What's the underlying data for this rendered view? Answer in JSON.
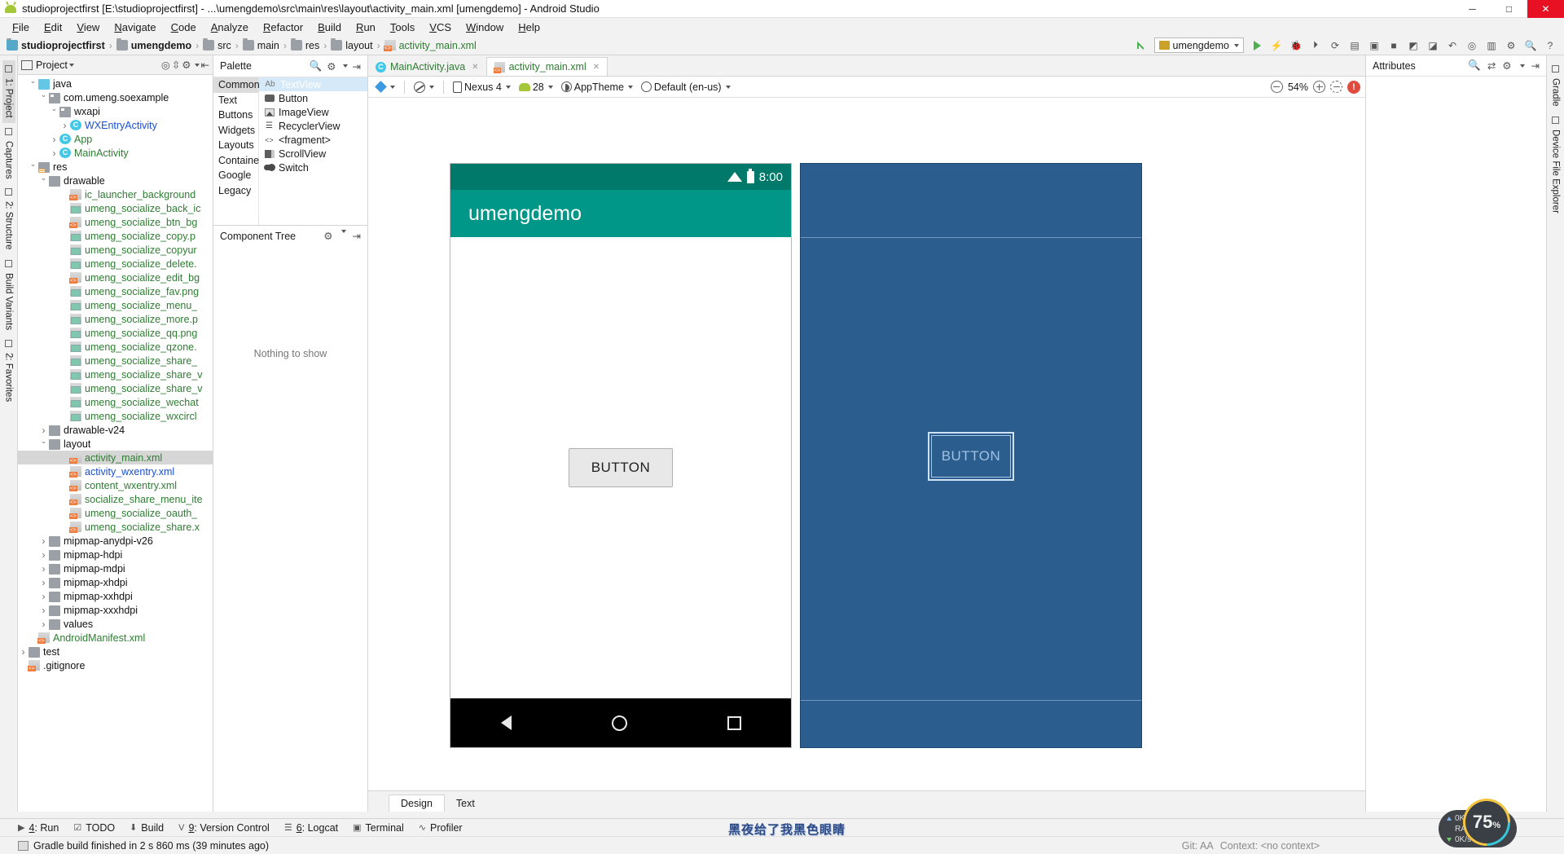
{
  "window": {
    "title": "studioprojectfirst [E:\\studioprojectfirst] - ...\\umengdemo\\src\\main\\res\\layout\\activity_main.xml [umengdemo] - Android Studio",
    "icon": "android-icon",
    "minimize": "─",
    "maximize": "□",
    "close": "✕"
  },
  "menubar": [
    "File",
    "Edit",
    "View",
    "Navigate",
    "Code",
    "Analyze",
    "Refactor",
    "Build",
    "Run",
    "Tools",
    "VCS",
    "Window",
    "Help"
  ],
  "breadcrumb": [
    {
      "label": "studioprojectfirst",
      "icon": "project-icon",
      "bold": true
    },
    {
      "label": "umengdemo",
      "icon": "module-icon",
      "bold": true
    },
    {
      "label": "src",
      "icon": "folder-icon",
      "bold": false
    },
    {
      "label": "main",
      "icon": "folder-icon",
      "bold": false
    },
    {
      "label": "res",
      "icon": "res-folder-icon",
      "bold": false
    },
    {
      "label": "layout",
      "icon": "folder-icon",
      "bold": false
    },
    {
      "label": "activity_main.xml",
      "icon": "xml-file-icon",
      "bold": false
    }
  ],
  "nav_toolbar": {
    "run_config": "umengdemo",
    "icons": [
      "back-arrow-icon",
      "run-icon",
      "apply-changes-icon",
      "debug-icon",
      "run-to-cursor-icon",
      "sync-gradle-icon",
      "avd-manager-icon",
      "sdk-manager-icon",
      "stop-icon",
      "layout-inspector-icon",
      "profiler-icon",
      "undo-icon",
      "search-everywhere-icon",
      "project-structure-icon",
      "settings-icon",
      "search-icon",
      "help-icon"
    ]
  },
  "left_rail": [
    {
      "label": "1: Project",
      "active": true,
      "icon": "project-tool-icon"
    },
    {
      "label": "Captures",
      "active": false,
      "icon": "captures-icon"
    },
    {
      "label": "2: Structure",
      "active": false,
      "icon": "structure-icon"
    },
    {
      "label": "Build Variants",
      "active": false,
      "icon": "build-variants-icon"
    },
    {
      "label": "2: Favorites",
      "active": false,
      "icon": "favorites-icon"
    }
  ],
  "right_rail": [
    {
      "label": "Gradle",
      "icon": "gradle-icon"
    },
    {
      "label": "Device File Explorer",
      "icon": "device-file-explorer-icon"
    }
  ],
  "project_panel": {
    "title": "Project",
    "tree": [
      {
        "depth": 4,
        "chev": "open",
        "icon": "java-folder-icon",
        "label": "java",
        "color": "dark"
      },
      {
        "depth": 5,
        "chev": "open",
        "icon": "package-icon",
        "label": "com.umeng.soexample",
        "color": "dark"
      },
      {
        "depth": 6,
        "chev": "open",
        "icon": "package-icon",
        "label": "wxapi",
        "color": "dark"
      },
      {
        "depth": 7,
        "chev": "closed",
        "icon": "class-icon",
        "label": "WXEntryActivity",
        "color": "blue"
      },
      {
        "depth": 6,
        "chev": "closed",
        "icon": "class-icon",
        "label": "App",
        "color": "green"
      },
      {
        "depth": 6,
        "chev": "closed",
        "icon": "class-icon",
        "label": "MainActivity",
        "color": "green"
      },
      {
        "depth": 4,
        "chev": "open",
        "icon": "res-folder-icon",
        "label": "res",
        "color": "dark"
      },
      {
        "depth": 5,
        "chev": "open",
        "icon": "folder-icon",
        "label": "drawable",
        "color": "dark"
      },
      {
        "depth": 7,
        "chev": "none",
        "icon": "xml-file-icon",
        "label": "ic_launcher_background",
        "color": "green"
      },
      {
        "depth": 7,
        "chev": "none",
        "icon": "png-file-icon",
        "label": "umeng_socialize_back_ic",
        "color": "green"
      },
      {
        "depth": 7,
        "chev": "none",
        "icon": "xml-file-icon",
        "label": "umeng_socialize_btn_bg",
        "color": "green"
      },
      {
        "depth": 7,
        "chev": "none",
        "icon": "png-file-icon",
        "label": "umeng_socialize_copy.p",
        "color": "green"
      },
      {
        "depth": 7,
        "chev": "none",
        "icon": "png-file-icon",
        "label": "umeng_socialize_copyur",
        "color": "green"
      },
      {
        "depth": 7,
        "chev": "none",
        "icon": "png-file-icon",
        "label": "umeng_socialize_delete.",
        "color": "green"
      },
      {
        "depth": 7,
        "chev": "none",
        "icon": "xml-file-icon",
        "label": "umeng_socialize_edit_bg",
        "color": "green"
      },
      {
        "depth": 7,
        "chev": "none",
        "icon": "png-file-icon",
        "label": "umeng_socialize_fav.png",
        "color": "green"
      },
      {
        "depth": 7,
        "chev": "none",
        "icon": "png-file-icon",
        "label": "umeng_socialize_menu_",
        "color": "green"
      },
      {
        "depth": 7,
        "chev": "none",
        "icon": "png-file-icon",
        "label": "umeng_socialize_more.p",
        "color": "green"
      },
      {
        "depth": 7,
        "chev": "none",
        "icon": "png-file-icon",
        "label": "umeng_socialize_qq.png",
        "color": "green"
      },
      {
        "depth": 7,
        "chev": "none",
        "icon": "png-file-icon",
        "label": "umeng_socialize_qzone.",
        "color": "green"
      },
      {
        "depth": 7,
        "chev": "none",
        "icon": "png-file-icon",
        "label": "umeng_socialize_share_",
        "color": "green"
      },
      {
        "depth": 7,
        "chev": "none",
        "icon": "png-file-icon",
        "label": "umeng_socialize_share_v",
        "color": "green"
      },
      {
        "depth": 7,
        "chev": "none",
        "icon": "png-file-icon",
        "label": "umeng_socialize_share_v",
        "color": "green"
      },
      {
        "depth": 7,
        "chev": "none",
        "icon": "png-file-icon",
        "label": "umeng_socialize_wechat",
        "color": "green"
      },
      {
        "depth": 7,
        "chev": "none",
        "icon": "png-file-icon",
        "label": "umeng_socialize_wxcircl",
        "color": "green"
      },
      {
        "depth": 5,
        "chev": "closed",
        "icon": "folder-icon",
        "label": "drawable-v24",
        "color": "dark"
      },
      {
        "depth": 5,
        "chev": "open",
        "icon": "folder-icon",
        "label": "layout",
        "color": "dark"
      },
      {
        "depth": 7,
        "chev": "none",
        "icon": "xml-file-icon",
        "label": "activity_main.xml",
        "color": "green",
        "selected": true
      },
      {
        "depth": 7,
        "chev": "none",
        "icon": "xml-file-icon",
        "label": "activity_wxentry.xml",
        "color": "blue"
      },
      {
        "depth": 7,
        "chev": "none",
        "icon": "xml-file-icon",
        "label": "content_wxentry.xml",
        "color": "green"
      },
      {
        "depth": 7,
        "chev": "none",
        "icon": "xml-file-icon",
        "label": "socialize_share_menu_ite",
        "color": "green"
      },
      {
        "depth": 7,
        "chev": "none",
        "icon": "xml-file-icon",
        "label": "umeng_socialize_oauth_",
        "color": "green"
      },
      {
        "depth": 7,
        "chev": "none",
        "icon": "xml-file-icon",
        "label": "umeng_socialize_share.x",
        "color": "green"
      },
      {
        "depth": 5,
        "chev": "closed",
        "icon": "folder-icon",
        "label": "mipmap-anydpi-v26",
        "color": "dark"
      },
      {
        "depth": 5,
        "chev": "closed",
        "icon": "folder-icon",
        "label": "mipmap-hdpi",
        "color": "dark"
      },
      {
        "depth": 5,
        "chev": "closed",
        "icon": "folder-icon",
        "label": "mipmap-mdpi",
        "color": "dark"
      },
      {
        "depth": 5,
        "chev": "closed",
        "icon": "folder-icon",
        "label": "mipmap-xhdpi",
        "color": "dark"
      },
      {
        "depth": 5,
        "chev": "closed",
        "icon": "folder-icon",
        "label": "mipmap-xxhdpi",
        "color": "dark"
      },
      {
        "depth": 5,
        "chev": "closed",
        "icon": "folder-icon",
        "label": "mipmap-xxxhdpi",
        "color": "dark"
      },
      {
        "depth": 5,
        "chev": "closed",
        "icon": "folder-icon",
        "label": "values",
        "color": "dark"
      },
      {
        "depth": 4,
        "chev": "none",
        "icon": "manifest-icon",
        "label": "AndroidManifest.xml",
        "color": "green"
      },
      {
        "depth": 3,
        "chev": "closed",
        "icon": "folder-icon",
        "label": "test",
        "color": "dark"
      },
      {
        "depth": 3,
        "chev": "none",
        "icon": "file-icon",
        "label": ".gitignore",
        "color": "dark"
      }
    ]
  },
  "editor_tabs": [
    {
      "label": "MainActivity.java",
      "icon": "class-icon",
      "active": false
    },
    {
      "label": "activity_main.xml",
      "icon": "xml-file-icon",
      "active": true
    }
  ],
  "palette": {
    "title": "Palette",
    "categories": [
      {
        "label": "Common",
        "active": true
      },
      {
        "label": "Text",
        "active": false
      },
      {
        "label": "Buttons",
        "active": false
      },
      {
        "label": "Widgets",
        "active": false
      },
      {
        "label": "Layouts",
        "active": false
      },
      {
        "label": "Containers",
        "active": false
      },
      {
        "label": "Google",
        "active": false
      },
      {
        "label": "Legacy",
        "active": false
      }
    ],
    "items": [
      {
        "label": "TextView",
        "icon": "textview-icon",
        "active": true
      },
      {
        "label": "Button",
        "icon": "button-icon",
        "active": false
      },
      {
        "label": "ImageView",
        "icon": "imageview-icon",
        "active": false
      },
      {
        "label": "RecyclerView",
        "icon": "recyclerview-icon",
        "active": false
      },
      {
        "label": "<fragment>",
        "icon": "fragment-icon",
        "active": false
      },
      {
        "label": "ScrollView",
        "icon": "scrollview-icon",
        "active": false
      },
      {
        "label": "Switch",
        "icon": "switch-icon",
        "active": false
      }
    ]
  },
  "component_tree": {
    "title": "Component Tree",
    "empty_text": "Nothing to show"
  },
  "design_toolbar": {
    "design_surface": "design-surface-icon",
    "orientation": "orientation-icon",
    "device": "Nexus 4",
    "api": "28",
    "theme": "AppTheme",
    "locale": "Default (en-us)",
    "zoom": "54%",
    "zoom_out": "zoom-out-icon",
    "zoom_in": "zoom-in-icon",
    "zoom_fit": "zoom-fit-icon",
    "error_count": "!"
  },
  "preview": {
    "status_time": "8:00",
    "app_title": "umengdemo",
    "button_label": "BUTTON",
    "blueprint_button_label": "BUTTON",
    "nav_back": "back-nav-icon",
    "nav_home": "home-nav-icon",
    "nav_recent": "recents-nav-icon"
  },
  "design_tabs": [
    {
      "label": "Design",
      "active": true
    },
    {
      "label": "Text",
      "active": false
    }
  ],
  "attributes_panel": {
    "title": "Attributes",
    "icons": [
      "search-icon",
      "expand-icon",
      "gear-icon",
      "collapse-icon"
    ]
  },
  "bottom_toolwindows": [
    {
      "num": "4",
      "label": "Run",
      "icon": "run-icon"
    },
    {
      "num": "",
      "label": "TODO",
      "icon": "todo-icon"
    },
    {
      "num": "",
      "label": "Build",
      "icon": "build-icon"
    },
    {
      "num": "9",
      "label": "Version Control",
      "icon": "version-control-icon"
    },
    {
      "num": "6",
      "label": "Logcat",
      "icon": "logcat-icon"
    },
    {
      "num": "",
      "label": "Terminal",
      "icon": "terminal-icon"
    },
    {
      "num": "",
      "label": "Profiler",
      "icon": "profiler-icon"
    }
  ],
  "statusbar": {
    "message": "Gradle build finished in 2 s 860 ms (39 minutes ago)",
    "git_branch": "Git: AA",
    "context": "Context: <no context>"
  },
  "watermark": "黑夜给了我黑色眼睛",
  "net_widget": {
    "upload": "0K/s",
    "download": "0K/s",
    "ram_label": "RAM",
    "ring_value": "75",
    "ring_unit": "%"
  },
  "colors": {
    "accent_teal": "#009688",
    "status_teal": "#00796b",
    "blueprint": "#2c5d8f",
    "selection": "#d6d6d6",
    "close_red": "#e81123"
  }
}
